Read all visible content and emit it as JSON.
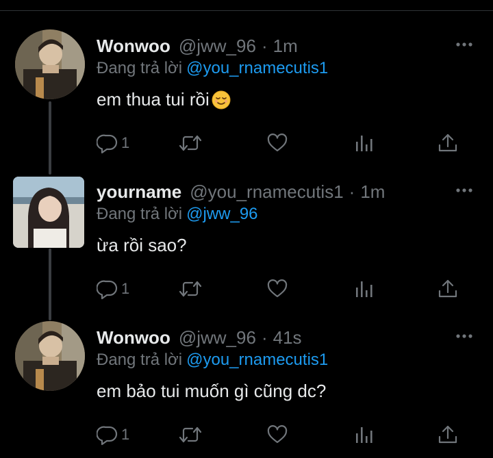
{
  "tweets": [
    {
      "display_name": "Wonwoo",
      "handle": "@jww_96",
      "separator": "·",
      "time": "1m",
      "reply_prefix": "Đang trả lời",
      "reply_to": "@you_rnamecutis1",
      "text": "em thua tui rồi",
      "reply_count": "1",
      "avatar_icon": "avatar-photo"
    },
    {
      "display_name": "yourname",
      "handle": "@you_rnamecutis1",
      "separator": "·",
      "time": "1m",
      "reply_prefix": "Đang trả lời",
      "reply_to": "@jww_96",
      "text": "ừa rồi sao?",
      "reply_count": "1",
      "avatar_icon": "avatar-photo"
    },
    {
      "display_name": "Wonwoo",
      "handle": "@jww_96",
      "separator": "·",
      "time": "41s",
      "reply_prefix": "Đang trả lời",
      "reply_to": "@you_rnamecutis1",
      "text": "em bảo tui muốn gì cũng dc?",
      "reply_count": "1",
      "avatar_icon": "avatar-photo"
    }
  ],
  "icons": {
    "more": "more-horizontal-icon",
    "reply": "reply-bubble-icon",
    "retweet": "retweet-icon",
    "like": "heart-icon",
    "views": "analytics-bars-icon",
    "share": "share-upload-icon",
    "emoji": "relieved-face-emoji"
  },
  "colors": {
    "background": "#000000",
    "primary_text": "#e7e9ea",
    "secondary_text": "#71767b",
    "accent": "#1d9bf0",
    "thread_line": "#3a3d41"
  }
}
